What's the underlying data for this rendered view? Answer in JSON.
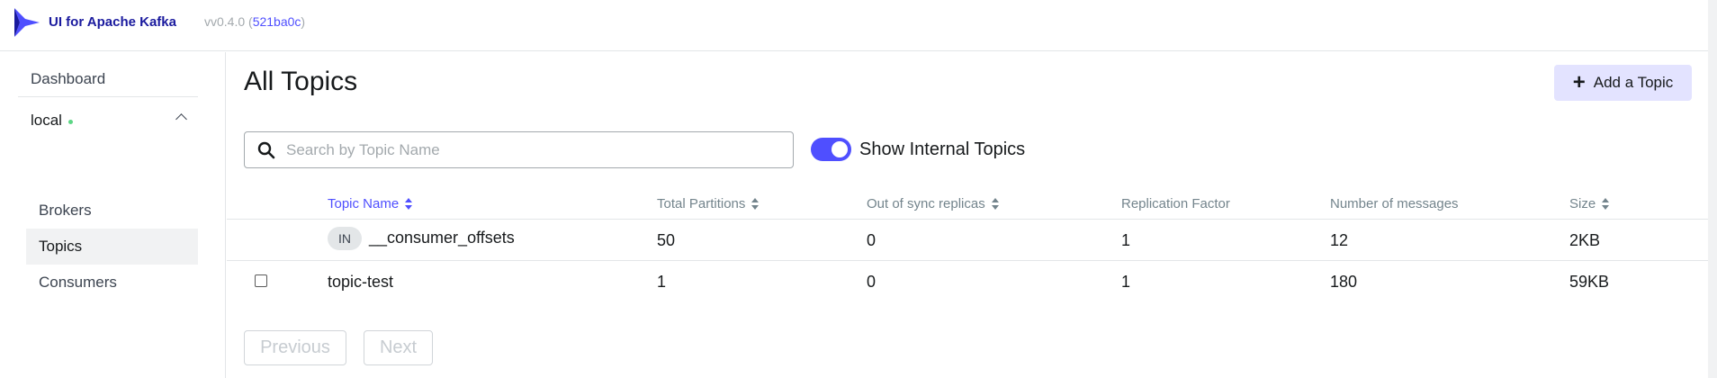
{
  "navbar": {
    "brand": "UI for Apache Kafka",
    "version_prefix": "vv0.4.0 (",
    "commit": "521ba0c",
    "version_suffix": ")"
  },
  "sidebar": {
    "dashboard": "Dashboard",
    "cluster": {
      "name": "local",
      "status": "online",
      "status_color": "#5cd685"
    },
    "items": [
      {
        "label": "Brokers",
        "active": false
      },
      {
        "label": "Topics",
        "active": true
      },
      {
        "label": "Consumers",
        "active": false
      }
    ]
  },
  "main": {
    "title": "All Topics",
    "add_button": {
      "icon": "plus-icon",
      "label": "Add a Topic"
    },
    "search": {
      "placeholder": "Search by Topic Name",
      "value": ""
    },
    "toggle": {
      "label": "Show Internal Topics",
      "checked": true
    },
    "table": {
      "headers": [
        {
          "label": "Topic Name",
          "sortable": true,
          "active": true
        },
        {
          "label": "Total Partitions",
          "sortable": true,
          "active": false
        },
        {
          "label": "Out of sync replicas",
          "sortable": true,
          "active": false
        },
        {
          "label": "Replication Factor",
          "sortable": false,
          "active": false
        },
        {
          "label": "Number of messages",
          "sortable": false,
          "active": false
        },
        {
          "label": "Size",
          "sortable": true,
          "active": false
        }
      ],
      "rows": [
        {
          "badge": "IN",
          "name": "__consumer_offsets",
          "partitions": "50",
          "out_of_sync": "0",
          "replication": "1",
          "messages": "12",
          "size": "2KB",
          "selectable": false
        },
        {
          "badge": "",
          "name": "topic-test",
          "partitions": "1",
          "out_of_sync": "0",
          "replication": "1",
          "messages": "180",
          "size": "59KB",
          "selectable": true
        }
      ]
    },
    "pagination": {
      "previous": "Previous",
      "next": "Next"
    }
  },
  "colors": {
    "accent": "#4f4fff",
    "brand": "#1a1a9e",
    "add_button_bg": "#e3e3ff"
  }
}
